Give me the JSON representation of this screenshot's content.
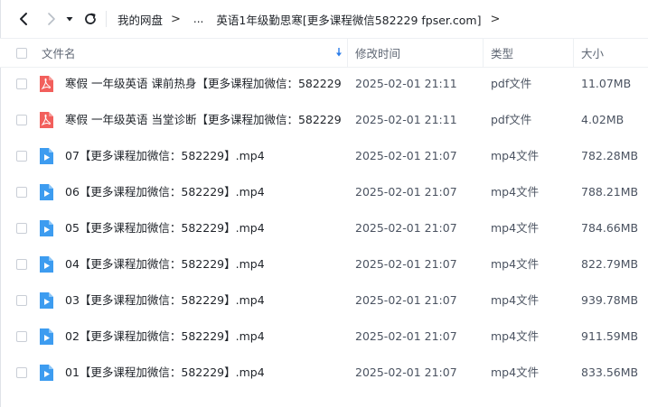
{
  "nav": {
    "back_icon": "chevron-left-icon",
    "forward_icon": "chevron-right-icon",
    "dropdown_icon": "caret-down-icon",
    "refresh_icon": "refresh-icon",
    "breadcrumbs": {
      "root": "我的网盘",
      "separator": ">",
      "ellipsis": "...",
      "current": "英语1年级勤思寒[更多课程微信582229 fpser.com]"
    }
  },
  "table": {
    "headers": {
      "name": "文件名",
      "modified": "修改时间",
      "type": "类型",
      "size": "大小"
    },
    "sort_icon": "sort-down-arrow-icon",
    "rows": [
      {
        "icon": "pdf",
        "name": "寒假 一年级英语 课前热身【更多课程加微信：582229...",
        "modified": "2025-02-01 21:11",
        "type": "pdf文件",
        "size": "11.07MB"
      },
      {
        "icon": "pdf",
        "name": "寒假 一年级英语 当堂诊断【更多课程加微信：582229...",
        "modified": "2025-02-01 21:11",
        "type": "pdf文件",
        "size": "4.02MB"
      },
      {
        "icon": "video",
        "name": "07【更多课程加微信：582229】.mp4",
        "modified": "2025-02-01 21:07",
        "type": "mp4文件",
        "size": "782.28MB"
      },
      {
        "icon": "video",
        "name": "06【更多课程加微信：582229】.mp4",
        "modified": "2025-02-01 21:07",
        "type": "mp4文件",
        "size": "788.21MB"
      },
      {
        "icon": "video",
        "name": "05【更多课程加微信：582229】.mp4",
        "modified": "2025-02-01 21:07",
        "type": "mp4文件",
        "size": "784.66MB"
      },
      {
        "icon": "video",
        "name": "04【更多课程加微信：582229】.mp4",
        "modified": "2025-02-01 21:07",
        "type": "mp4文件",
        "size": "822.79MB"
      },
      {
        "icon": "video",
        "name": "03【更多课程加微信：582229】.mp4",
        "modified": "2025-02-01 21:07",
        "type": "mp4文件",
        "size": "939.78MB"
      },
      {
        "icon": "video",
        "name": "02【更多课程加微信：582229】.mp4",
        "modified": "2025-02-01 21:07",
        "type": "mp4文件",
        "size": "911.59MB"
      },
      {
        "icon": "video",
        "name": "01【更多课程加微信：582229】.mp4",
        "modified": "2025-02-01 21:07",
        "type": "mp4文件",
        "size": "833.56MB"
      }
    ]
  },
  "colors": {
    "pdf_icon": "#f25f5c",
    "video_icon": "#3d9cf0",
    "sort_arrow": "#2b7de9"
  }
}
